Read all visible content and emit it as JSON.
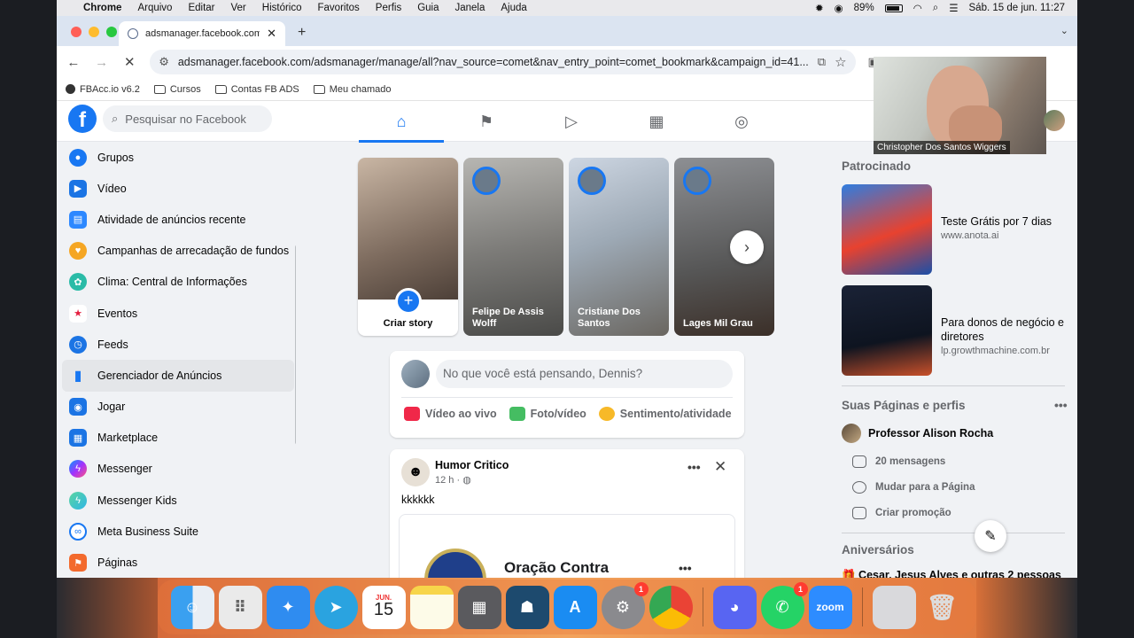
{
  "menubar": {
    "items": [
      "Chrome",
      "Arquivo",
      "Editar",
      "Ver",
      "Histórico",
      "Favoritos",
      "Perfis",
      "Guia",
      "Janela",
      "Ajuda"
    ],
    "battery": "89%",
    "datetime": "Sáb. 15 de jun.  11:27"
  },
  "browser": {
    "tab_title": "adsmanager.facebook.com/a",
    "url": "adsmanager.facebook.com/adsmanager/manage/all?nav_source=comet&nav_entry_point=comet_bookmark&campaign_id=41...",
    "bookmarks": [
      "FBAcc.io v6.2",
      "Cursos",
      "Contas FB ADS",
      "Meu chamado"
    ]
  },
  "facebook": {
    "search_placeholder": "Pesquisar no Facebook",
    "left_menu": [
      "Grupos",
      "Vídeo",
      "Atividade de anúncios recente",
      "Campanhas de arrecadação de fundos",
      "Clima: Central de Informações",
      "Eventos",
      "Feeds",
      "Gerenciador de Anúncios",
      "Jogar",
      "Marketplace",
      "Messenger",
      "Messenger Kids",
      "Meta Business Suite",
      "Páginas"
    ],
    "stories": {
      "create_label": "Criar story",
      "items": [
        "Felipe De Assis Wolff",
        "Cristiane Dos Santos",
        "Lages Mil Grau"
      ]
    },
    "composer": {
      "placeholder": "No que você está pensando, Dennis?",
      "actions": [
        "Vídeo ao vivo",
        "Foto/vídeo",
        "Sentimento/atividade"
      ]
    },
    "post": {
      "author": "Humor Critico",
      "time": "12 h · ",
      "text": "kkkkkk",
      "card_title": "Oração Contra"
    },
    "right": {
      "sponsored_header": "Patrocinado",
      "ads": [
        {
          "title": "Teste Grátis por 7 dias",
          "url": "www.anota.ai"
        },
        {
          "title": "Para donos de negócio e diretores",
          "url": "lp.growthmachine.com.br"
        }
      ],
      "pages_header": "Suas Páginas e perfis",
      "page_name": "Professor Alison Rocha",
      "page_actions": [
        "20 mensagens",
        "Mudar para a Página",
        "Criar promoção"
      ],
      "birthdays_header": "Aniversários",
      "birthday_text": "Cesar, Jesus Alves e outras 2 pessoas"
    }
  },
  "webcam": {
    "name": "Christopher Dos Santos Wiggers"
  },
  "dock": {
    "calendar_month": "JUN.",
    "calendar_day": "15",
    "zoom_label": "zoom",
    "badge": "1"
  },
  "colors": {
    "fb_blue": "#1877f2",
    "page_bg": "#f0f2f5"
  }
}
